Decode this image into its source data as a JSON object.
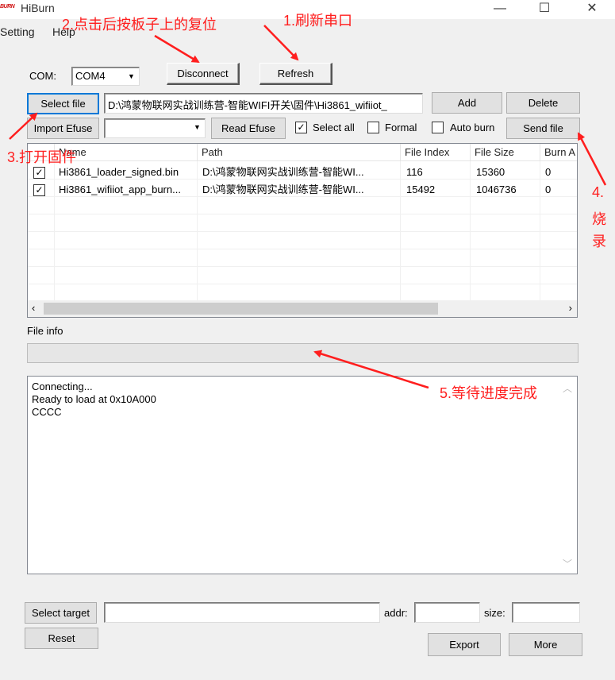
{
  "window": {
    "logo": "BURN",
    "title": "HiBurn",
    "minimize": "—",
    "maximize": "☐",
    "close": "✕"
  },
  "menu": [
    "Setting",
    "Help"
  ],
  "com": {
    "label": "COM:",
    "value": "COM4",
    "disconnect": "Disconnect",
    "refresh": "Refresh"
  },
  "file_row": {
    "select_file": "Select file",
    "path": "D:\\鸿蒙物联网实战训练营-智能WIFI开关\\固件\\Hi3861_wifiiot_",
    "add": "Add",
    "delete": "Delete"
  },
  "efuse_row": {
    "import_efuse": "Import Efuse",
    "efuse_value": "",
    "read_efuse": "Read Efuse",
    "select_all": "Select all",
    "formal": "Formal",
    "auto_burn": "Auto burn",
    "send_file": "Send file"
  },
  "table": {
    "columns": [
      "Name",
      "Path",
      "File Index",
      "File Size",
      "Burn A"
    ],
    "rows": [
      {
        "checked": true,
        "name": "Hi3861_loader_signed.bin",
        "path": "D:\\鸿蒙物联网实战训练营-智能WI...",
        "index": "116",
        "size": "15360",
        "burn": "0"
      },
      {
        "checked": true,
        "name": "Hi3861_wifiiot_app_burn...",
        "path": "D:\\鸿蒙物联网实战训练营-智能WI...",
        "index": "15492",
        "size": "1046736",
        "burn": "0"
      }
    ]
  },
  "file_info": {
    "label": "File info"
  },
  "log": [
    "Connecting...",
    "Ready to load at 0x10A000",
    "CCCC"
  ],
  "bottom": {
    "select_target": "Select target",
    "addr_label": "addr:",
    "size_label": "size:",
    "reset": "Reset",
    "export": "Export",
    "more": "More"
  },
  "annotations": {
    "a1": "1.刷新串口",
    "a2": "2.点击后按板子上的复位",
    "a3": "3.打开固件",
    "a4a": "4.",
    "a4b": "烧",
    "a4c": "录",
    "a5": "5.等待进度完成",
    "color": "#ff1e1e"
  }
}
